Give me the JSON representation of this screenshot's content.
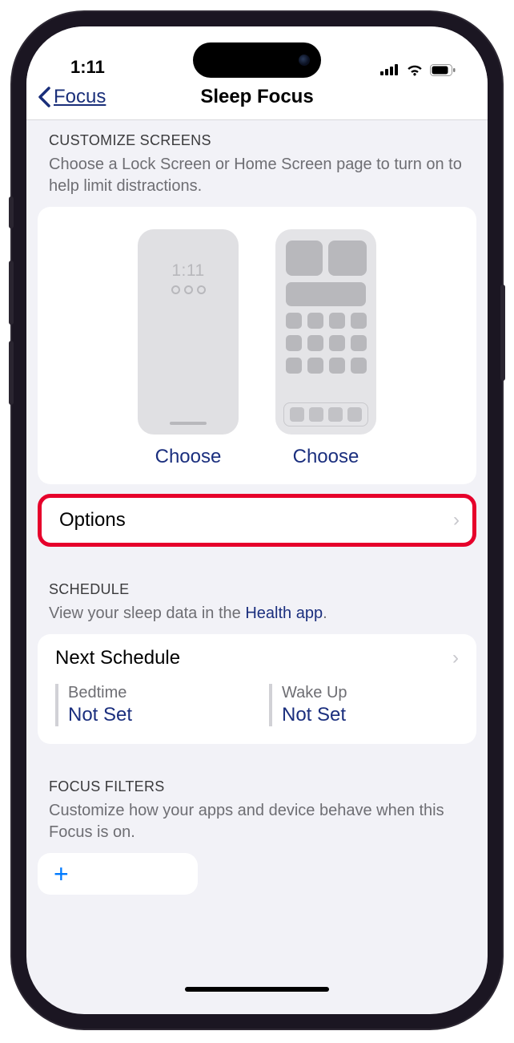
{
  "status": {
    "time": "1:11"
  },
  "nav": {
    "back_label": "Focus",
    "title": "Sleep Focus"
  },
  "customize": {
    "header": "Customize Screens",
    "sub": "Choose a Lock Screen or Home Screen page to turn on to help limit distractions.",
    "lock_clock": "1:11",
    "choose_label_lock": "Choose",
    "choose_label_home": "Choose"
  },
  "options": {
    "label": "Options"
  },
  "schedule": {
    "header": "Schedule",
    "sub_pre": "View your sleep data in the ",
    "sub_link": "Health app",
    "sub_post": ".",
    "next_label": "Next Schedule",
    "bedtime_label": "Bedtime",
    "bedtime_value": "Not Set",
    "wakeup_label": "Wake Up",
    "wakeup_value": "Not Set"
  },
  "filters": {
    "header": "Focus Filters",
    "sub": "Customize how your apps and device behave when this Focus is on."
  }
}
